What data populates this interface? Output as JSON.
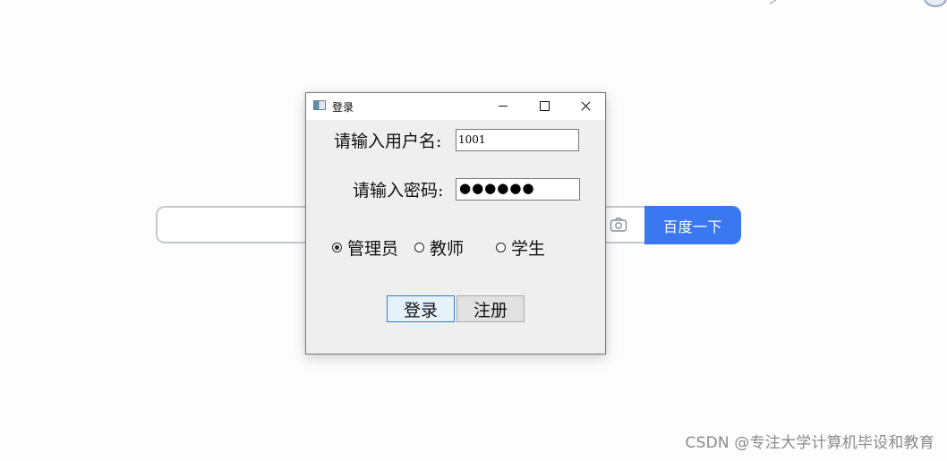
{
  "background": {
    "search_button_label": "百度一下",
    "watermark": "CSDN @专注大学计算机毕设和教育",
    "accent_color": "#3a78f2"
  },
  "dialog": {
    "title": "登录",
    "username_label": "请输入用户名:",
    "username_value": "1001",
    "password_label": "请输入密码:",
    "password_value": "●●●●●●",
    "roles": [
      {
        "label": "管理员",
        "checked": true
      },
      {
        "label": "教师",
        "checked": false
      },
      {
        "label": "学生",
        "checked": false
      }
    ],
    "login_button": "登录",
    "register_button": "注册"
  }
}
